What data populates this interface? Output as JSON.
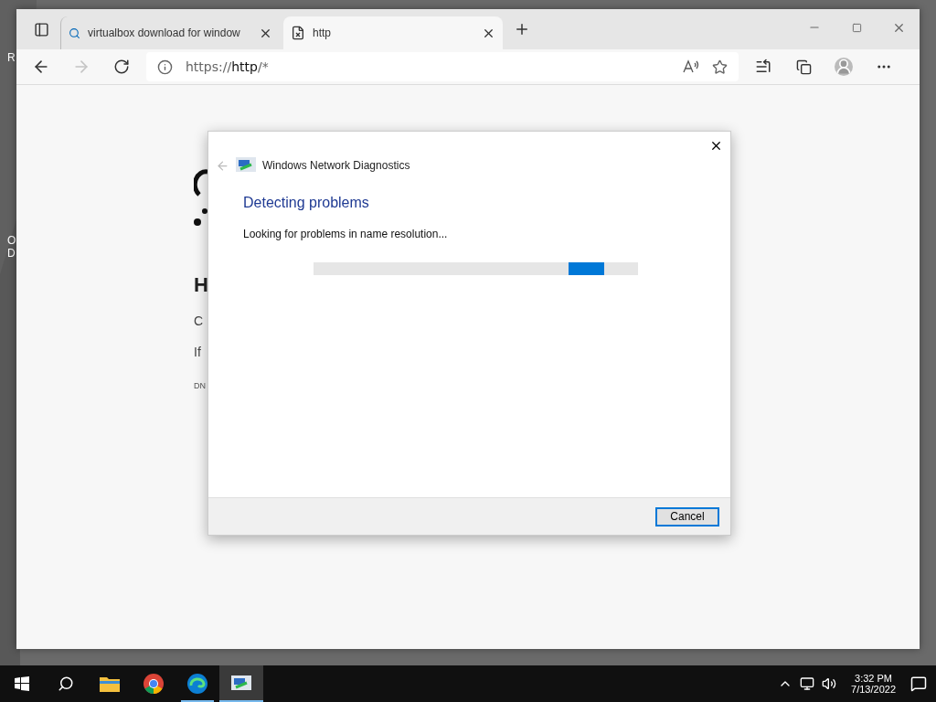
{
  "desktop": {
    "icon_labels": [
      "R",
      "O",
      "D"
    ]
  },
  "browser": {
    "tabs": [
      {
        "kind": "search",
        "label": "virtualbox download for window",
        "selected": false
      },
      {
        "kind": "error",
        "label": "http",
        "selected": true
      }
    ],
    "nav": [
      {
        "kind": "back",
        "disabled": false
      },
      {
        "kind": "forward",
        "disabled": true
      },
      {
        "kind": "refresh",
        "disabled": false
      }
    ],
    "address": "https://**http**/*",
    "page": {
      "heading": "H",
      "lines": [
        "C",
        "If"
      ],
      "code": "DN"
    }
  },
  "dialog": {
    "title": "Windows Network Diagnostics",
    "back_disabled": true,
    "heading": "Detecting problems",
    "status": "Looking for problems in name resolution...",
    "progress": {
      "kind": "marquee"
    },
    "buttons": [
      {
        "label": "Cancel",
        "focused": true
      }
    ]
  },
  "taskbar": {
    "apps": [
      {
        "kind": "explorer",
        "running": false,
        "selected": false
      },
      {
        "kind": "chrome",
        "running": false,
        "selected": false
      },
      {
        "kind": "edge",
        "running": true,
        "selected": false
      },
      {
        "kind": "diagnostics",
        "running": true,
        "selected": true
      }
    ],
    "time": "3:32 PM",
    "date": "7/13/2022"
  }
}
